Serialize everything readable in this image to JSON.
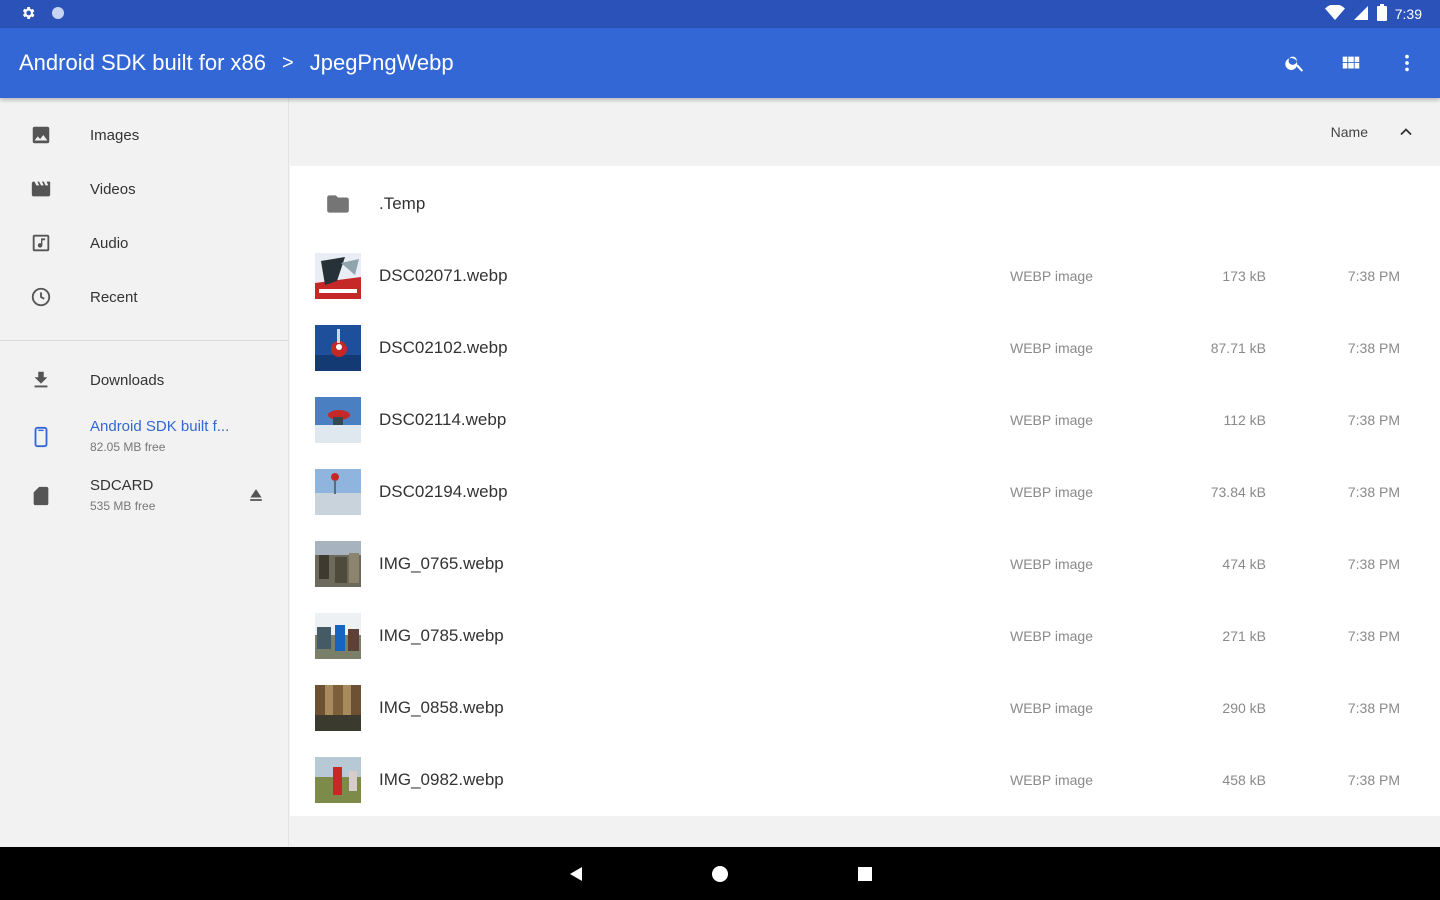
{
  "status_bar": {
    "time": "7:39",
    "left_icons": [
      "settings-gear-icon",
      "circle-notification-icon"
    ],
    "right_icons": [
      "wifi-icon",
      "cell-signal-icon",
      "battery-icon"
    ]
  },
  "toolbar": {
    "breadcrumb_root": "Android SDK built for x86",
    "breadcrumb_sep": ">",
    "breadcrumb_current": "JpegPngWebp",
    "actions": [
      "search-icon",
      "grid-view-icon",
      "more-vert-icon"
    ],
    "color": "#3367d6"
  },
  "sidebar": {
    "items": [
      {
        "label": "Images",
        "icon": "image-icon"
      },
      {
        "label": "Videos",
        "icon": "video-icon"
      },
      {
        "label": "Audio",
        "icon": "audio-icon"
      },
      {
        "label": "Recent",
        "icon": "clock-icon"
      }
    ],
    "storage": [
      {
        "label": "Downloads",
        "sub": "",
        "icon": "download-icon"
      },
      {
        "label": "Android SDK built f...",
        "sub": "82.05 MB free",
        "icon": "phone-icon",
        "selected": true
      },
      {
        "label": "SDCARD",
        "sub": "535 MB free",
        "icon": "sdcard-icon",
        "action": "eject-icon"
      }
    ],
    "selected_color": "#3367d6"
  },
  "sort": {
    "label": "Name",
    "direction": "ascending"
  },
  "files": [
    {
      "name": ".Temp",
      "type": "",
      "size": "",
      "time": "",
      "kind": "folder"
    },
    {
      "name": "DSC02071.webp",
      "type": "WEBP image",
      "size": "173 kB",
      "time": "7:38 PM",
      "kind": "image"
    },
    {
      "name": "DSC02102.webp",
      "type": "WEBP image",
      "size": "87.71 kB",
      "time": "7:38 PM",
      "kind": "image"
    },
    {
      "name": "DSC02114.webp",
      "type": "WEBP image",
      "size": "112 kB",
      "time": "7:38 PM",
      "kind": "image"
    },
    {
      "name": "DSC02194.webp",
      "type": "WEBP image",
      "size": "73.84 kB",
      "time": "7:38 PM",
      "kind": "image"
    },
    {
      "name": "IMG_0765.webp",
      "type": "WEBP image",
      "size": "474 kB",
      "time": "7:38 PM",
      "kind": "image"
    },
    {
      "name": "IMG_0785.webp",
      "type": "WEBP image",
      "size": "271 kB",
      "time": "7:38 PM",
      "kind": "image"
    },
    {
      "name": "IMG_0858.webp",
      "type": "WEBP image",
      "size": "290 kB",
      "time": "7:38 PM",
      "kind": "image"
    },
    {
      "name": "IMG_0982.webp",
      "type": "WEBP image",
      "size": "458 kB",
      "time": "7:38 PM",
      "kind": "image"
    }
  ],
  "nav_bar": [
    "back-icon",
    "home-icon",
    "recents-icon"
  ]
}
